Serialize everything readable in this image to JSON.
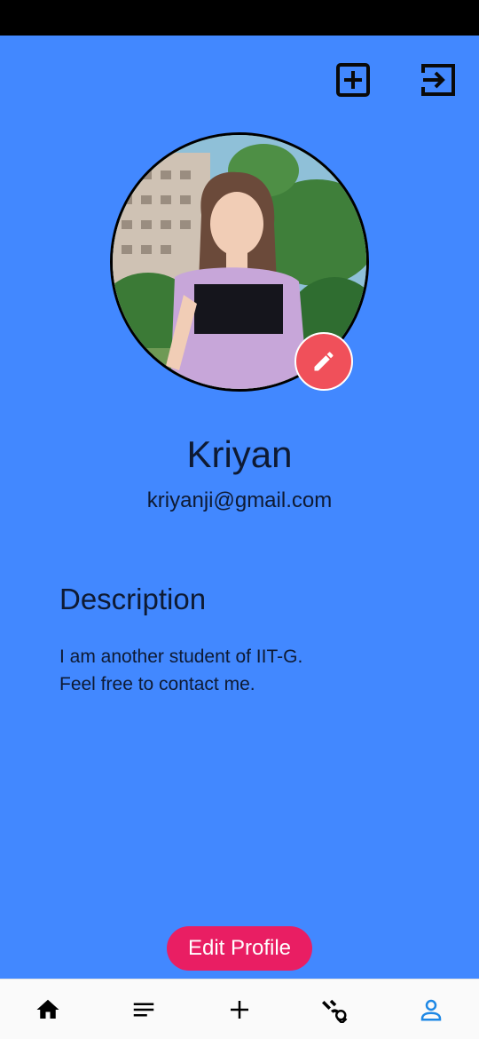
{
  "profile": {
    "name": "Kriyan",
    "email": "kriyanji@gmail.com"
  },
  "description": {
    "heading": "Description",
    "line1": "I am another student of IIT-G.",
    "line2": "Feel free to contact me."
  },
  "actions": {
    "edit_profile_label": "Edit Profile"
  },
  "icons": {
    "top_left": "add-box-icon",
    "top_right": "logout-icon",
    "edit_photo": "pencil-icon",
    "nav": [
      "home-icon",
      "list-icon",
      "add-icon",
      "connections-icon",
      "person-icon"
    ]
  },
  "colors": {
    "background": "#4288ff",
    "edit_profile_button": "#e91e63",
    "edit_photo_button": "#f0505a",
    "active_nav": "#1e88e5"
  },
  "bottom_nav": {
    "active_index": 4
  }
}
